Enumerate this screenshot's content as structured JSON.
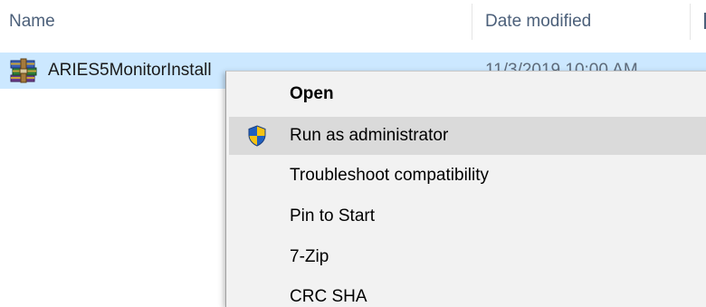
{
  "columns": {
    "name": "Name",
    "date_modified": "Date modified"
  },
  "file": {
    "name": "ARIES5MonitorInstall",
    "date": "11/3/2019 10:00 AM",
    "icon": "winrar-archive-icon",
    "selected": true
  },
  "context_menu": {
    "items": [
      {
        "label": "Open",
        "bold": true,
        "icon": null
      },
      {
        "label": "Run as administrator",
        "bold": false,
        "icon": "uac-shield-icon",
        "hovered": true
      },
      {
        "label": "Troubleshoot compatibility",
        "bold": false,
        "icon": null
      },
      {
        "label": "Pin to Start",
        "bold": false,
        "icon": null
      },
      {
        "label": "7-Zip",
        "bold": false,
        "icon": null
      },
      {
        "label": "CRC SHA",
        "bold": false,
        "icon": null
      }
    ]
  },
  "colors": {
    "header_text": "#4c607a",
    "selection_bg": "#cce8ff",
    "menu_bg": "#f2f2f2",
    "menu_hover_bg": "#dadada",
    "shield_blue": "#1f5fbf",
    "shield_yellow": "#f5c211"
  }
}
